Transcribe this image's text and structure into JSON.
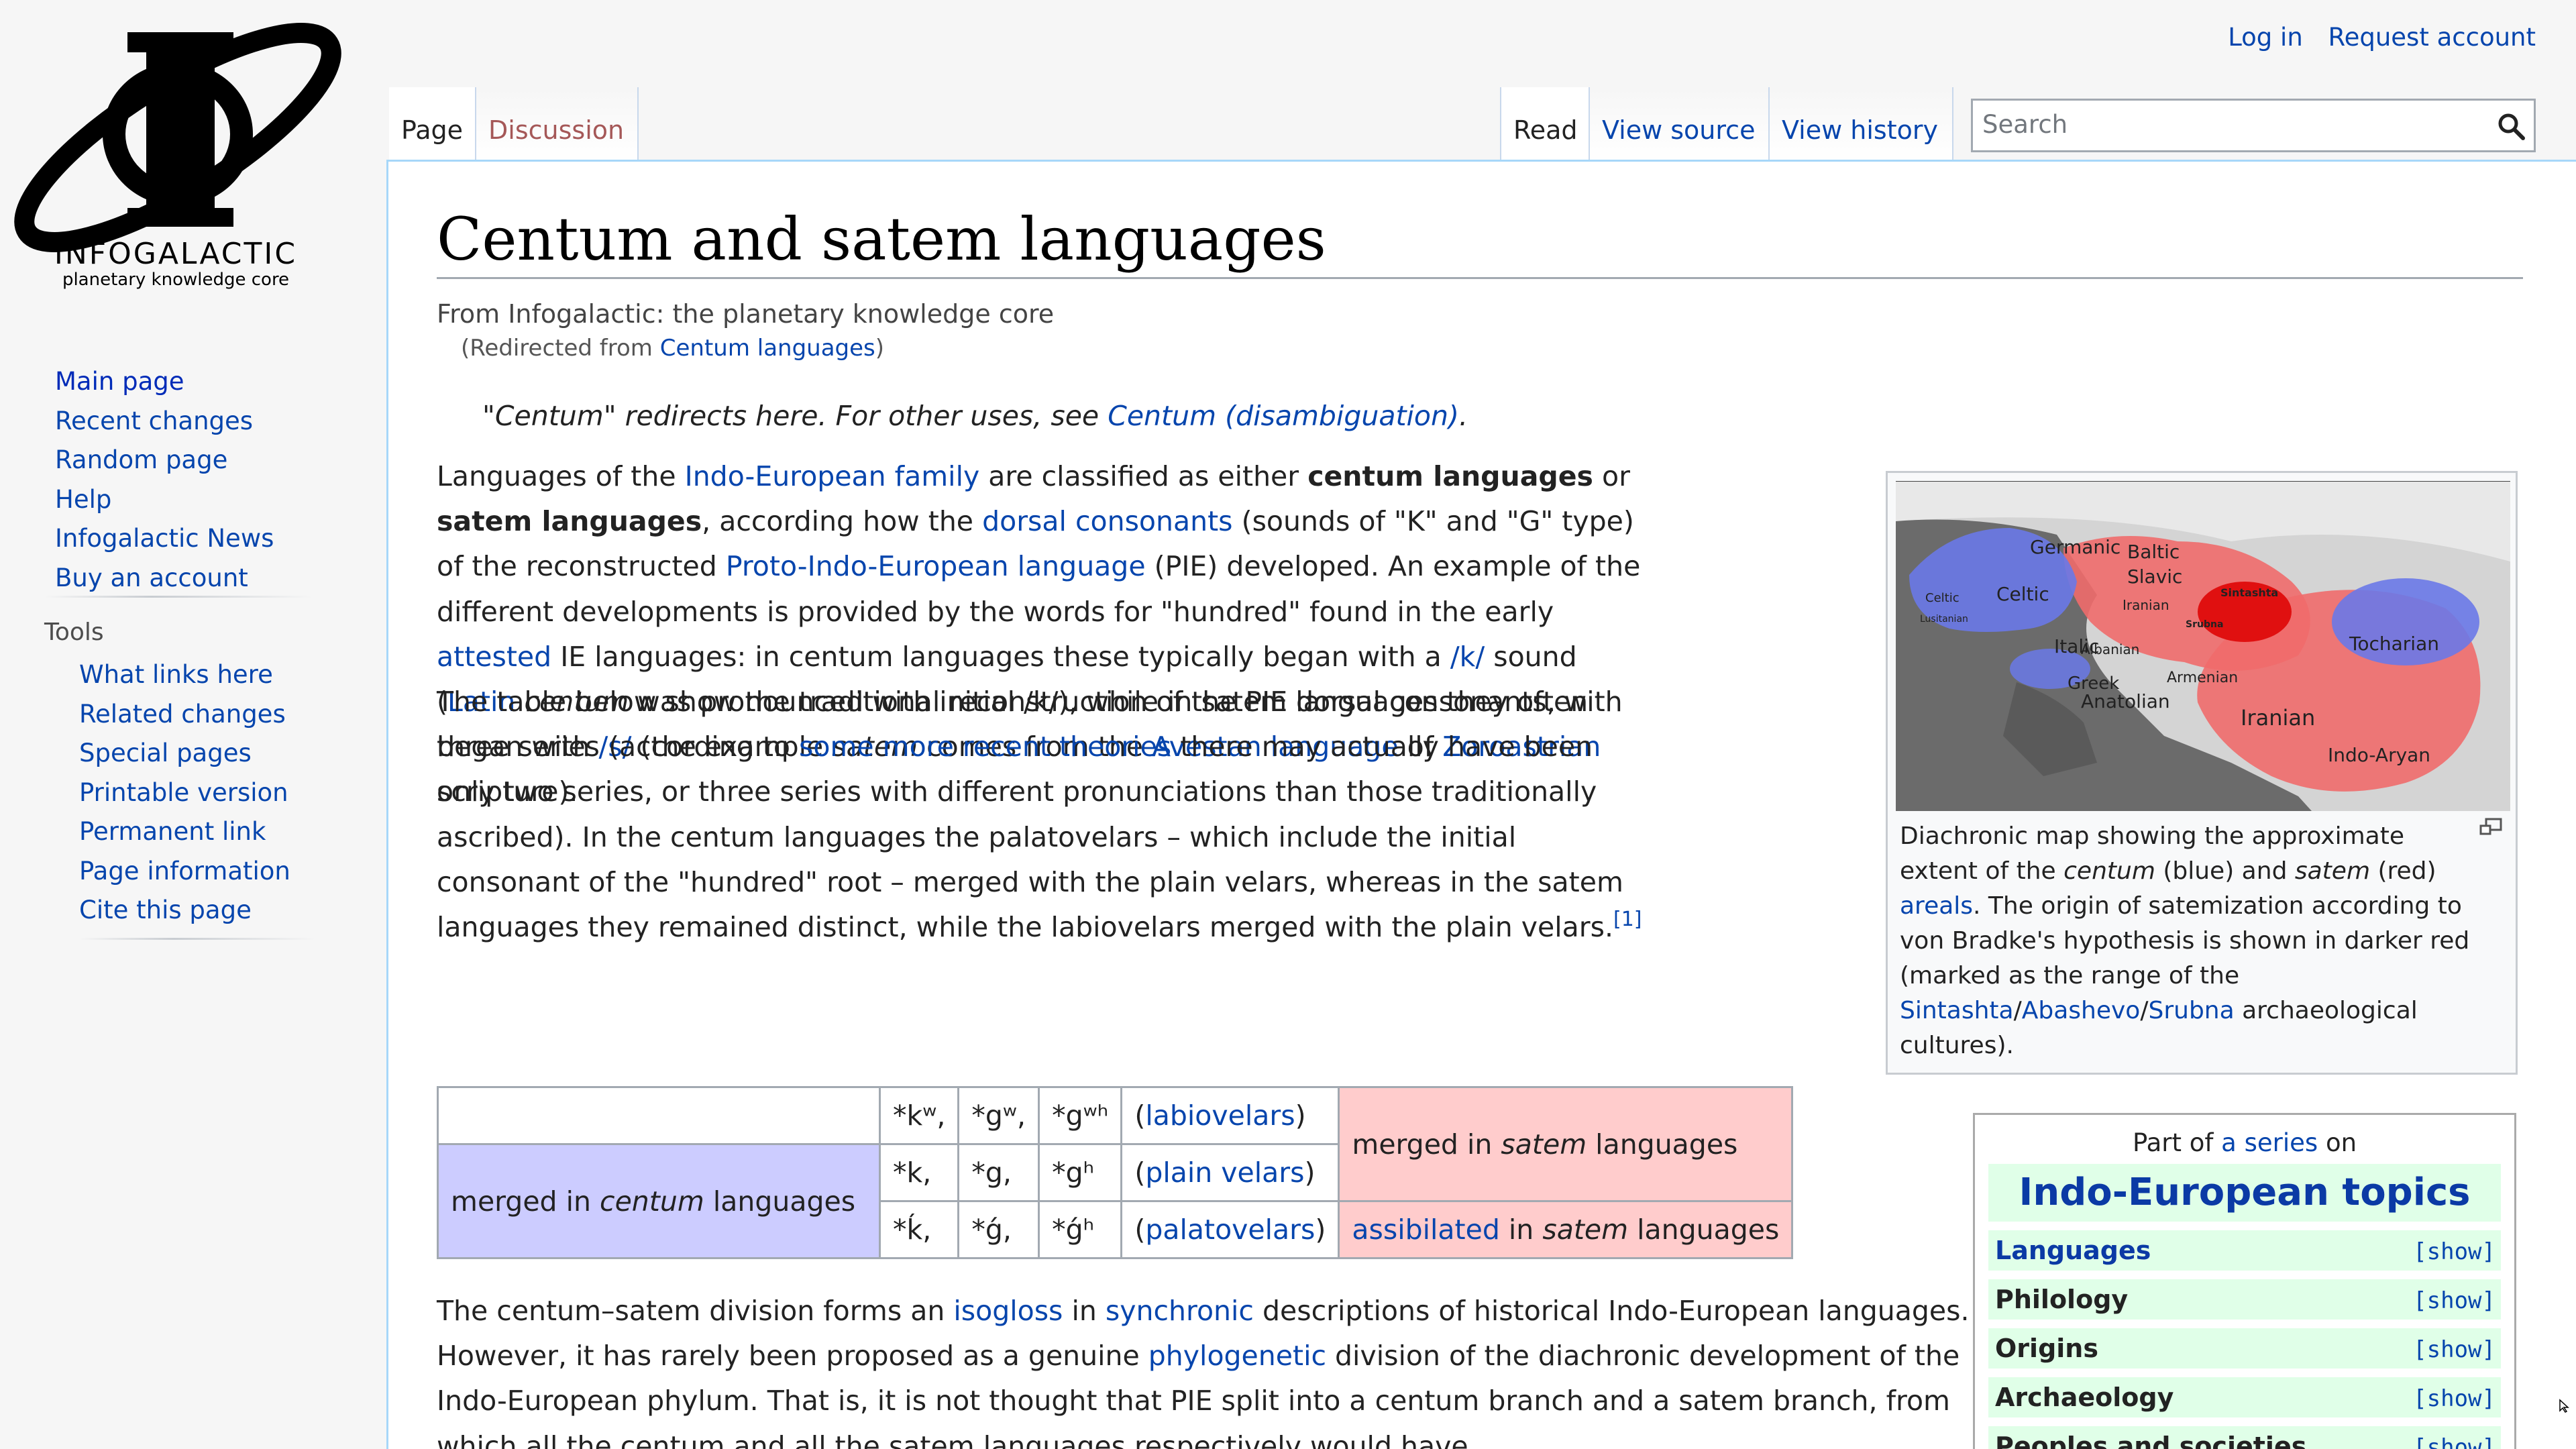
{
  "site": {
    "logo_word": "INFOGALACTIC",
    "logo_tagline": "planetary knowledge core"
  },
  "navigation": {
    "main": [
      "Main page",
      "Recent changes",
      "Random page",
      "Help",
      "Infogalactic News",
      "Buy an account"
    ],
    "tools_heading": "Tools",
    "tools": [
      "What links here",
      "Related changes",
      "Special pages",
      "Printable version",
      "Permanent link",
      "Page information",
      "Cite this page"
    ]
  },
  "personal": {
    "login": "Log in",
    "request": "Request account"
  },
  "tabs": {
    "page": "Page",
    "discussion": "Discussion",
    "read": "Read",
    "view_source": "View source",
    "view_history": "View history"
  },
  "search": {
    "placeholder": "Search"
  },
  "article": {
    "title": "Centum and satem languages",
    "tagline": "From Infogalactic: the planetary knowledge core",
    "redirect_prefix": "(Redirected from ",
    "redirect_link": "Centum languages",
    "redirect_suffix": ")",
    "hatnote_text": "\"Centum\" redirects here. For other uses, see ",
    "hatnote_link": "Centum (disambiguation)",
    "hatnote_end": "."
  },
  "paragraphs": {
    "p1": [
      {
        "t": "Languages of the "
      },
      {
        "t": "Indo-European family",
        "a": true
      },
      {
        "t": " are classified as either "
      },
      {
        "t": "centum languages",
        "b": true
      },
      {
        "t": " or "
      },
      {
        "t": "satem languages",
        "b": true
      },
      {
        "t": ", according how the "
      },
      {
        "t": "dorsal consonants",
        "a": true
      },
      {
        "t": " (sounds of \"K\" and \"G\" type) of the reconstructed "
      },
      {
        "t": "Proto-Indo-European language",
        "a": true
      },
      {
        "t": " (PIE) developed. An example of the different developments is provided by the words for \"hundred\" found in the early "
      },
      {
        "t": "attested",
        "a": true
      },
      {
        "t": " IE languages: in centum languages these typically began with a "
      },
      {
        "t": "/k/",
        "a": true
      },
      {
        "t": " sound ("
      },
      {
        "t": "Latin",
        "a": true
      },
      {
        "t": " "
      },
      {
        "t": "centum",
        "i": true
      },
      {
        "t": " was pronounced with initial /k/), while in satem languages they often began with "
      },
      {
        "t": "/s/",
        "a": true
      },
      {
        "t": " (the example "
      },
      {
        "t": "satem",
        "i": true
      },
      {
        "t": " comes from the "
      },
      {
        "t": "Avestan language",
        "a": true
      },
      {
        "t": " of "
      },
      {
        "t": "Zoroastrian",
        "a": true
      },
      {
        "t": " scripture)."
      }
    ],
    "p2": [
      {
        "t": "The table below show the traditional reconstruction of the PIE dorsal consonants, with three series (according to "
      },
      {
        "t": "some more recent theories",
        "a": true
      },
      {
        "t": " there may actually have been only two series, or three series with different pronunciations than those traditionally ascribed). In the centum languages the palatovelars – which include the initial consonant of the \"hundred\" root – merged with the plain velars, whereas in the satem languages they remained distinct, while the labiovelars merged with the plain velars."
      },
      {
        "t": "[1]",
        "a": true,
        "sup": true
      }
    ],
    "p3": [
      {
        "t": "The centum–satem division forms an "
      },
      {
        "t": "isogloss",
        "a": true
      },
      {
        "t": " in "
      },
      {
        "t": "synchronic",
        "a": true
      },
      {
        "t": " descriptions of historical Indo-European languages. However, it has rarely been proposed as a genuine "
      },
      {
        "t": "phylogenetic",
        "a": true
      },
      {
        "t": " division of the diachronic development of the Indo-European phylum. That is, it is not thought that PIE split into a centum branch and a satem branch, from which all the centum and all the satem languages respectively would have"
      }
    ]
  },
  "table": {
    "rows": [
      {
        "c1": "*kʷ,",
        "c2": "*gʷ,",
        "c3": "*gʷʰ",
        "pre": "(",
        "link": "labiovelars",
        "post": ")"
      },
      {
        "c1": "*k,",
        "c2": "*g,",
        "c3": "*gʰ",
        "pre": "(",
        "link": "plain velars",
        "post": ")"
      },
      {
        "c1": "*ḱ,",
        "c2": "*ǵ,",
        "c3": "*ǵʰ",
        "pre": "(",
        "link": "palatovelars",
        "post": ")"
      }
    ],
    "centum": {
      "pre": "merged in ",
      "em": "centum",
      "post": " languages"
    },
    "satem": {
      "pre": "merged in ",
      "em": "satem",
      "post": " languages"
    },
    "assib": {
      "link": "assibilated",
      "mid": " in ",
      "em": "satem",
      "post": " languages"
    },
    "colors": {
      "centum": "#ccccff",
      "satem": "#ffcccc"
    }
  },
  "thumbnail": {
    "map_labels": [
      "Germanic",
      "Baltic",
      "Slavic",
      "Celtic",
      "Celtic",
      "Lusitanian",
      "Iranian",
      "Sintashta",
      "Srubna",
      "Tocharian",
      "Italic",
      "Albanian",
      "Greek",
      "Armenian",
      "Anatolian",
      "Iranian",
      "Indo-Aryan"
    ],
    "caption": [
      {
        "t": "Diachronic map showing the approximate extent of the "
      },
      {
        "t": "centum",
        "i": true
      },
      {
        "t": " (blue) and "
      },
      {
        "t": "satem",
        "i": true
      },
      {
        "t": " (red) "
      },
      {
        "t": "areals",
        "a": true
      },
      {
        "t": ". The origin of satemization according to von Bradke's hypothesis is shown in darker red (marked as the range of the "
      },
      {
        "t": "Sintashta",
        "a": true
      },
      {
        "t": "/"
      },
      {
        "t": "Abashevo",
        "a": true
      },
      {
        "t": "/"
      },
      {
        "t": "Srubna",
        "a": true
      },
      {
        "t": " archaeological cultures)."
      }
    ]
  },
  "navbox": {
    "pre": "Part of ",
    "pre_link": "a series",
    "pre_post": " on",
    "title": "Indo-European topics",
    "rows": [
      {
        "label": "Languages",
        "link": true,
        "show": "[show]"
      },
      {
        "label": "Philology",
        "link": false,
        "show": "[show]"
      },
      {
        "label": "Origins",
        "link": false,
        "show": "[show]"
      },
      {
        "label": "Archaeology",
        "link": false,
        "show": "[show]"
      },
      {
        "label": "Peoples and societies",
        "link": false,
        "show": "[show]"
      }
    ]
  }
}
